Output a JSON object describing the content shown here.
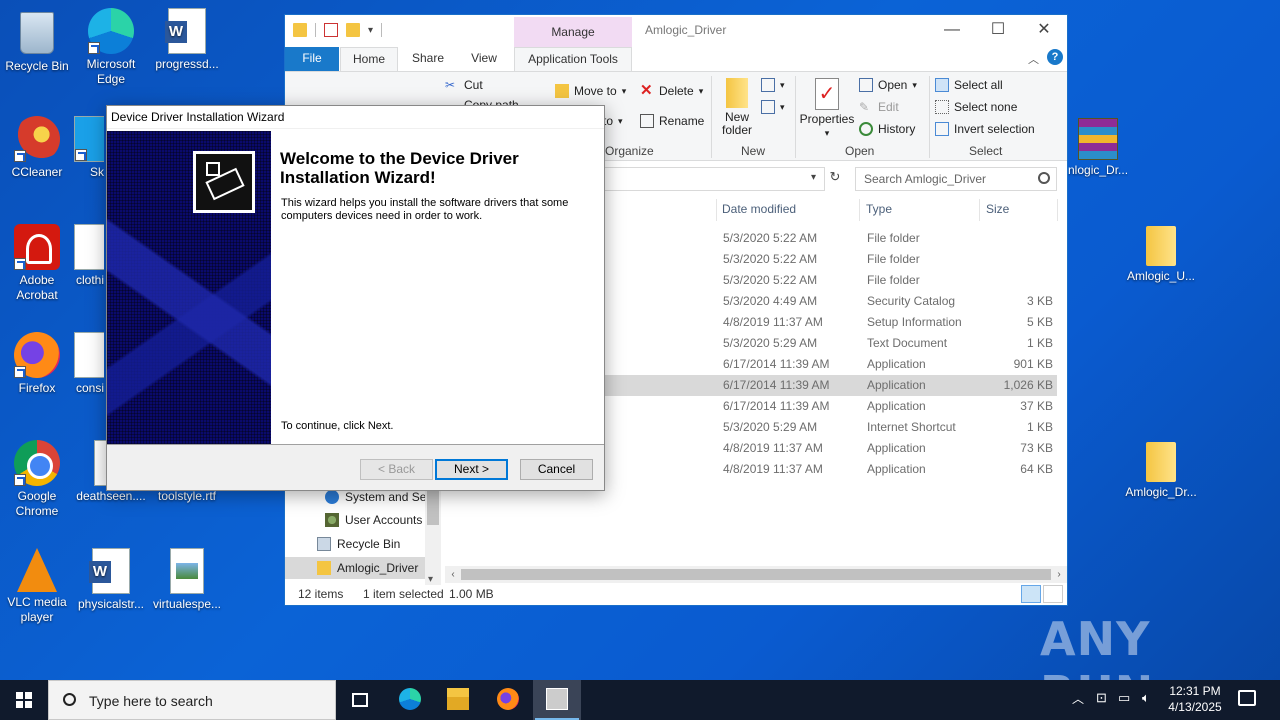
{
  "desktop": {
    "icons_left": [
      {
        "label": "Recycle Bin",
        "icon": "recycle-bin-icon"
      },
      {
        "label": "CCleaner",
        "icon": "ccleaner-icon"
      },
      {
        "label": "Adobe Acrobat",
        "icon": "adobe-acrobat-icon"
      },
      {
        "label": "Firefox",
        "icon": "firefox-icon"
      },
      {
        "label": "Google Chrome",
        "icon": "chrome-icon"
      },
      {
        "label": "VLC media player",
        "icon": "vlc-icon"
      }
    ],
    "icons_col2": [
      {
        "label": "Microsoft Edge",
        "icon": "edge-icon"
      },
      {
        "label": "Sk",
        "icon": "skype-icon"
      },
      {
        "label": "clothi",
        "icon": "word-doc-icon"
      },
      {
        "label": "consi",
        "icon": "doc-icon"
      },
      {
        "label": "deathseen....",
        "icon": "doc-icon"
      },
      {
        "label": "physicalstr...",
        "icon": "word-doc-icon"
      }
    ],
    "icons_col3": [
      {
        "label": "progressd...",
        "icon": "word-doc-icon"
      },
      {
        "label": "toolstyle.rtf",
        "icon": "doc-icon"
      },
      {
        "label": "virtualespe...",
        "icon": "image-icon"
      }
    ],
    "icons_right": [
      {
        "label": "nlogic_Dr...",
        "icon": "winrar-icon"
      },
      {
        "label": "Amlogic_U...",
        "icon": "folder-icon"
      },
      {
        "label": "Amlogic_Dr...",
        "icon": "folder-icon"
      }
    ],
    "watermark": "ANY RUN"
  },
  "explorer": {
    "window_title": "Amlogic_Driver",
    "manage_label": "Manage",
    "tabs": {
      "file": "File",
      "home": "Home",
      "share": "Share",
      "view": "View",
      "app_tools": "Application Tools"
    },
    "ribbon": {
      "cut": "Cut",
      "copy_path": "Copy path",
      "move_to": "Move to",
      "copy_to": "to",
      "delete": "Delete",
      "rename": "Rename",
      "new_folder": "New folder",
      "properties": "Properties",
      "open": "Open",
      "edit": "Edit",
      "history": "History",
      "select_all": "Select all",
      "select_none": "Select none",
      "invert_selection": "Invert selection",
      "groups": {
        "organize": "Organize",
        "new": "New",
        "open": "Open",
        "select": "Select"
      }
    },
    "search_placeholder": "Search Amlogic_Driver",
    "columns": {
      "date": "Date modified",
      "type": "Type",
      "size": "Size"
    },
    "files": [
      {
        "date": "5/3/2020 5:22 AM",
        "type": "File folder",
        "size": "",
        "selected": false
      },
      {
        "date": "5/3/2020 5:22 AM",
        "type": "File folder",
        "size": "",
        "selected": false
      },
      {
        "date": "5/3/2020 5:22 AM",
        "type": "File folder",
        "size": "",
        "selected": false
      },
      {
        "date": "5/3/2020 4:49 AM",
        "type": "Security Catalog",
        "size": "3 KB",
        "selected": false
      },
      {
        "date": "4/8/2019 11:37 AM",
        "type": "Setup Information",
        "size": "5 KB",
        "selected": false
      },
      {
        "date": "5/3/2020 5:29 AM",
        "type": "Text Document",
        "size": "1 KB",
        "selected": false
      },
      {
        "date": "6/17/2014 11:39 AM",
        "type": "Application",
        "size": "901 KB",
        "selected": false
      },
      {
        "date": "6/17/2014 11:39 AM",
        "type": "Application",
        "size": "1,026 KB",
        "selected": true
      },
      {
        "date": "6/17/2014 11:39 AM",
        "type": "Application",
        "size": "37 KB",
        "selected": false
      },
      {
        "date": "5/3/2020 5:29 AM",
        "type": "Internet Shortcut",
        "size": "1 KB",
        "selected": false
      },
      {
        "date": "4/8/2019 11:37 AM",
        "type": "Application",
        "size": "73 KB",
        "selected": false
      },
      {
        "date": "4/8/2019 11:37 AM",
        "type": "Application",
        "size": "64 KB",
        "selected": false
      }
    ],
    "nav": [
      {
        "label": "System and Se",
        "icon": "control-panel-icon",
        "selected": false
      },
      {
        "label": "User Accounts",
        "icon": "user-accounts-icon",
        "selected": false
      },
      {
        "label": "Recycle Bin",
        "icon": "recycle-bin-icon",
        "selected": false
      },
      {
        "label": "Amlogic_Driver",
        "icon": "folder-icon",
        "selected": true
      }
    ],
    "status": {
      "items": "12 items",
      "selection": "1 item selected",
      "size": "1.00 MB"
    }
  },
  "wizard": {
    "title": "Device Driver Installation Wizard",
    "heading": "Welcome to the Device Driver Installation Wizard!",
    "description": "This wizard helps you install the software drivers that some computers devices need in order to work.",
    "continue_text": "To continue, click Next.",
    "back_label": "< Back",
    "next_label": "Next >",
    "cancel_label": "Cancel"
  },
  "taskbar": {
    "search_placeholder": "Type here to search",
    "time": "12:31 PM",
    "date": "4/13/2025"
  }
}
